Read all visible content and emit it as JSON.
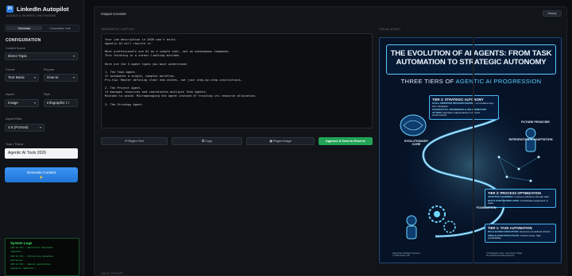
{
  "brand": {
    "title": "LinkedIn Autopilot",
    "subtitle": "AGENTIC WORKFLOW ENGINE",
    "logo": "in"
  },
  "mode_tabs": [
    "Generate",
    "Competitor Hub"
  ],
  "config": {
    "heading": "CONFIGURATION",
    "content_source_label": "Content Source",
    "content_source_value": "Direct Topic",
    "format_label": "Format",
    "format_value": "Text Basic",
    "purpose_label": "Purpose",
    "purpose_value": "How-to",
    "aspect_label": "Aspect",
    "aspect_value": "Image",
    "style_label": "Style",
    "style_value": "Infographic / I",
    "ratio_label": "Aspect Ratio",
    "ratio_value": "4:5 (Portrait)",
    "topic_label": "Topic / Theme",
    "topic_value": "Agentic AI Tools 2026",
    "generate_label": "Generate Content",
    "generate_icon": "⚡"
  },
  "logs": {
    "title": "System Logs",
    "lines": [
      "[00:21:55]  ✓  Watchlist Tabulator",
      "    complete.",
      "[00:21:55]  ✓  Extracting metadata",
      "    sentences...",
      "[00:21:55]  ✓  Neural generation",
      "    sequence complete./"
    ]
  },
  "output": {
    "title": "Output Console",
    "history_label": "History",
    "caption_label": "GENERATED CAPTION",
    "visual_label": "VISUAL ASSET",
    "caption_lines": [
      "Your job description in 2026 won't exist.",
      "Agentic AI will rewrite it.",
      "",
      "Most professionals use AI as a simple tool, not an autonomous teammate.",
      "This thinking is a career-limiting mistake.",
      "",
      "Here are the 3 agent types you must understand:",
      "",
      "1. The Task Agent.",
      "It automates a single, complex workflow.",
      "Pro-tip: Master defining clear end-states, not just step-by-step instructions.",
      "",
      "2. The Project Agent.",
      "It manages resources and coordinates multiple Task Agents.",
      "Mistake to avoid: Micromanaging the agent instead of trusting its resource allocation.",
      "",
      "3. The Strategy Agent."
    ],
    "buttons": {
      "regen_text": "Regen Text",
      "copy": "Copy",
      "regen_image": "Regen Image",
      "approve": "Approve & Send to Reserve"
    },
    "prompt_label": "IMAGE PROMPT"
  },
  "infographic": {
    "title_line1": "THE EVOLUTION OF AI AGENTS: FROM TASK",
    "title_line2": "AUTOMATION TO STRATEGIC AUTONOMY",
    "subtitle_plain": "THREE TIERS OF ",
    "subtitle_accent": "AGENTIC AI PROGRESSION",
    "tier3": {
      "title": "TIER 3: STRATEGIC AUTONOMY",
      "p1_bold": "GOAL-ORIENTED DECISION MAKING:",
      "p1_text": "Formulates long-term strategies.",
      "p2_bold": "CONTEXTUAL AWARENESS & SELF-DIRECTED ACTION:",
      "p2_text": "Operates independently in dynamic environments."
    },
    "tier2": {
      "title": "TIER 2: PROCESS OPTIMIZATION",
      "p1_bold": "ADAPTIVE LEARNING:",
      "p1_text": "Improves efficiency through data.",
      "p2_bold": "MULTI-STEP WORKFLOWS:",
      "p2_text": "Coordinates sequences of tasks."
    },
    "tier1": {
      "title": "TIER 1: TASK AUTOMATION",
      "p1_bold": "RULE-BASED EXECUTION:",
      "p1_text": "Executes pre-defined actions.",
      "p2_bold": "SINGLE-FUNCTION FOCUS:",
      "p2_text": "Limited scope, high predictability."
    },
    "labels": {
      "evolutionary_core": "EVOLUTIONARY CORE",
      "future_frontier": "FUTURE FRONTIER",
      "integration": "INTEGRATION & ADAPTATION",
      "foundation": "FOUNDATION"
    },
    "footer_left": [
      "Advancing Intelligent Systems",
      "© 2026 Future Lab"
    ],
    "footer_right": [
      "AI Infographic View: Learn Every Stage",
      "No Unauthorized Reproduction"
    ]
  }
}
